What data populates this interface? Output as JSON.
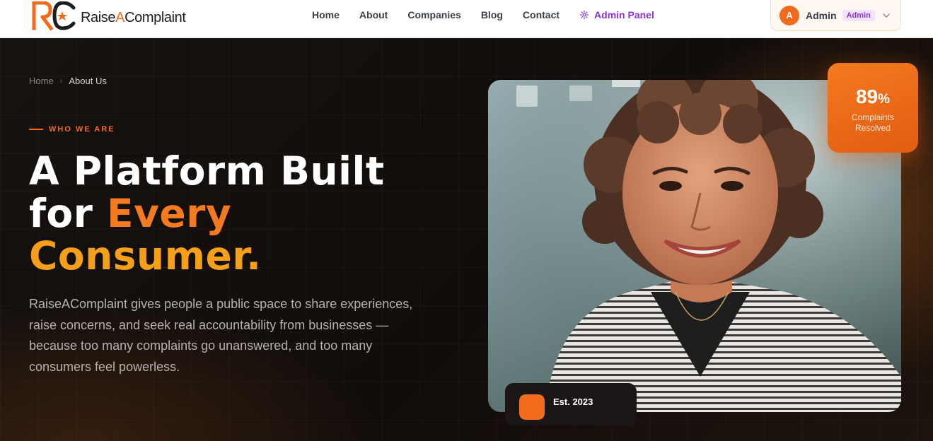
{
  "brand": {
    "name_part1": "Raise",
    "name_part2": "A",
    "name_part3": "Complaint"
  },
  "nav": {
    "items": [
      {
        "label": "Home"
      },
      {
        "label": "About"
      },
      {
        "label": "Companies"
      },
      {
        "label": "Blog"
      },
      {
        "label": "Contact"
      }
    ],
    "admin_panel": "Admin Panel"
  },
  "user": {
    "initial": "A",
    "name": "Admin",
    "role": "Admin"
  },
  "breadcrumb": {
    "home": "Home",
    "current": "About Us"
  },
  "hero": {
    "eyebrow": "WHO WE ARE",
    "headline_line1": "A Platform Built",
    "headline_line2_prefix": "for ",
    "headline_line2_accent": "Every",
    "headline_line3": "Consumer.",
    "lead": "RaiseAComplaint gives people a public space to share experiences, raise concerns, and seek real accountability from businesses — because too many complaints go unanswered, and too many consumers feel powerless."
  },
  "stat": {
    "value": "89",
    "unit": "%",
    "label_line1": "Complaints",
    "label_line2": "Resolved"
  },
  "est": {
    "label": "Est. 2023"
  },
  "colors": {
    "brand_orange": "#f26b1d",
    "brand_amber": "#f5a018",
    "admin_purple": "#8a32e0",
    "hero_background": "#120d0b"
  },
  "icons": {
    "admin": "gear-icon",
    "user_menu": "chevron-down-icon",
    "breadcrumb": "chevron-right-icon"
  }
}
